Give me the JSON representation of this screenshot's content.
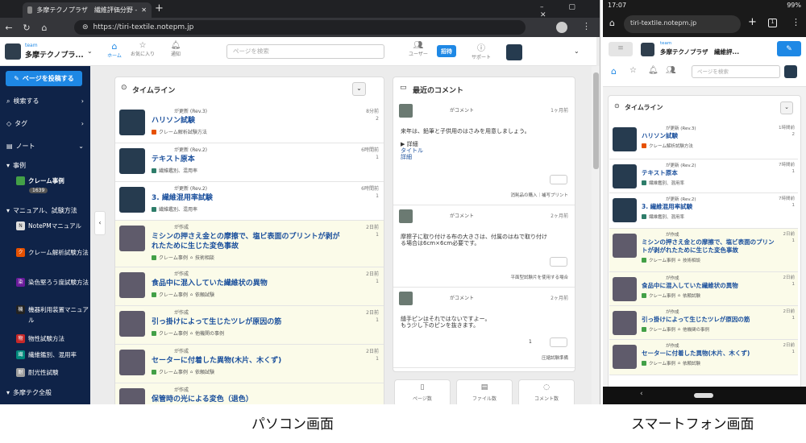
{
  "browser": {
    "tab_title": "多摩テクノプラザ　繊維評価分野 -",
    "url": "https://tiri-textile.notepm.jp"
  },
  "header": {
    "team_label": "team",
    "team_name": "多摩テクノプラ...",
    "nav": [
      "ホーム",
      "お気に入り",
      "通知"
    ],
    "search_placeholder": "ページを検索",
    "users": "ユーザー",
    "invite": "招待",
    "support": "サポート"
  },
  "sidebar": {
    "post_button": "ページを投稿する",
    "items": [
      "検索する",
      "タグ",
      "ノート"
    ],
    "section_jirei": "事例",
    "claim_note": "クレーム事例",
    "claim_count": "1639",
    "section_manual": "マニュアル、試験方法",
    "notes": [
      "NotePMマニュアル",
      "クレーム解析試験方法",
      "染色堅ろう度試験方法",
      "機器利用装置マニュアル",
      "物性試験方法",
      "繊維鑑別、混用率",
      "耐光性試験"
    ],
    "note_initials": [
      "N",
      "ク",
      "染",
      "機",
      "物",
      "繊",
      "耐"
    ],
    "section_tama": "多摩テク全般"
  },
  "timeline": {
    "title": "タイムライン",
    "items": [
      {
        "who": "が更新 (Rev.3)",
        "title": "ハリソン試験",
        "tags": [
          "クレーム解析試験方法"
        ],
        "time": "8分前",
        "count": "2"
      },
      {
        "who": "が更新 (Rev.2)",
        "title": "テキスト原本",
        "tags": [
          "繊維鑑別、混用率"
        ],
        "time": "6時間前",
        "count": "1"
      },
      {
        "who": "が更新 (Rev.2)",
        "title": "3. 繊維混用率試験",
        "tags": [
          "繊維鑑別、混用率"
        ],
        "time": "6時間前",
        "count": "1"
      },
      {
        "who": "が作成",
        "title": "ミシンの押さえ金との摩擦で、塩ビ表面のプリントが剥がれたために生じた変色事故",
        "tags": [
          "クレーム事例",
          "技術相談"
        ],
        "time": "2日前",
        "count": "1"
      },
      {
        "who": "が作成",
        "title": "食品中に混入していた繊維状の異物",
        "tags": [
          "クレーム事例",
          "依頼試験"
        ],
        "time": "2日前",
        "count": "1"
      },
      {
        "who": "が作成",
        "title": "引っ掛けによって生じたツレが原因の筋",
        "tags": [
          "クレーム事例",
          "他機関の事例"
        ],
        "time": "2日前",
        "count": "1"
      },
      {
        "who": "が作成",
        "title": "セーターに付着した異物(木片、木くず)",
        "tags": [
          "クレーム事例",
          "依頼試験"
        ],
        "time": "2日前",
        "count": "1"
      },
      {
        "who": "が作成",
        "title": "保管時の光による変色（退色）",
        "tags": [],
        "time": "",
        "count": ""
      }
    ]
  },
  "comments": {
    "title": "最近のコメント",
    "items": [
      {
        "who": "がコメント",
        "time": "1ヶ月前",
        "body": [
          "来年は、鉛筆と子供用のはさみを用意しましょう。",
          "",
          "▶ 詳細",
          "タイトル",
          "詳細"
        ],
        "source": "消耗品の購入｜補写プリント"
      },
      {
        "who": "がコメント",
        "time": "2ヶ月前",
        "body": [
          "摩擦子に取り付ける布の大きさは、付属のはねで取り付け",
          "る場合は6cm×6cm必要です。"
        ],
        "source": "平面型試験片を使用する場合"
      },
      {
        "who": "がコメント",
        "time": "2ヶ月前",
        "body": [
          "縫手ピンはそれではないですよー。",
          "もう少し下のピンを抜きます。"
        ],
        "source": "圧縮試験準備",
        "reaction": "1"
      }
    ],
    "stats": [
      "ページ数",
      "ファイル数",
      "コメント数"
    ]
  },
  "mobile": {
    "status_time": "17:07",
    "status_battery": "99%",
    "url": "tiri-textile.notepm.jp",
    "team_label": "team",
    "team_name": "多摩テクノプラザ　繊維評...",
    "search_placeholder": "ページを検索",
    "timeline_title": "タイムライン",
    "items": [
      {
        "who": "が更新 (Rev.3)",
        "title": "ハリソン試験",
        "tags": [
          "クレーム解析試験方法"
        ],
        "time": "1時間前",
        "count": "2"
      },
      {
        "who": "が更新 (Rev.2)",
        "title": "テキスト原本",
        "tags": [
          "繊維鑑別、混用率"
        ],
        "time": "7時間前",
        "count": "1"
      },
      {
        "who": "が更新 (Rev.2)",
        "title": "3. 繊維混用率試験",
        "tags": [
          "繊維鑑別、混用率"
        ],
        "time": "7時間前",
        "count": "1"
      },
      {
        "who": "が作成",
        "title": "ミシンの押さえ金との摩擦で、塩ビ表面のプリントが剥がれたために生じた変色事故",
        "tags": [
          "クレーム事例",
          "技術相談"
        ],
        "time": "2日前",
        "count": "1"
      },
      {
        "who": "が作成",
        "title": "食品中に混入していた繊維状の異物",
        "tags": [
          "クレーム事例",
          "依頼試験"
        ],
        "time": "2日前",
        "count": "1"
      },
      {
        "who": "が作成",
        "title": "引っ掛けによって生じたツレが原因の筋",
        "tags": [
          "クレーム事例",
          "他機関の事例"
        ],
        "time": "2日前",
        "count": "1"
      },
      {
        "who": "が作成",
        "title": "セーターに付着した異物(木片、木くず)",
        "tags": [
          "クレーム事例",
          "依頼試験"
        ],
        "time": "2日前",
        "count": "1"
      }
    ]
  },
  "captions": {
    "pc": "パソコン画面",
    "sp": "スマートフォン画面"
  },
  "colors": {
    "navy": "#0f2348",
    "primary": "#1e88e5",
    "claim": "#43a047",
    "claim_analysis": "#e65100",
    "title_link": "#1a4f9c",
    "thumb_dark": "#263b4f",
    "thumb_gray": "#5f5b6b"
  }
}
